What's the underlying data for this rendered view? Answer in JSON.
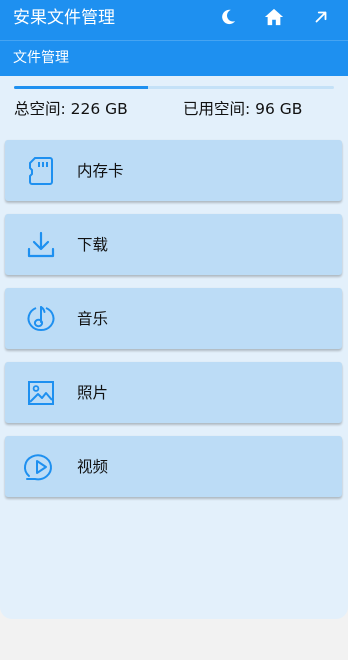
{
  "appbar": {
    "title": "安果文件管理",
    "actions": [
      {
        "icon": "moon-icon"
      },
      {
        "icon": "home-icon"
      },
      {
        "icon": "arrow-up-right-icon"
      }
    ]
  },
  "subbar": {
    "title": "文件管理"
  },
  "storage": {
    "total_label": "总空间: 226 GB",
    "used_label": "已用空间: 96 GB",
    "used_fraction": 0.42
  },
  "categories": [
    {
      "label": "内存卡",
      "icon": "sd-card-icon"
    },
    {
      "label": "下载",
      "icon": "download-icon"
    },
    {
      "label": "音乐",
      "icon": "music-icon"
    },
    {
      "label": "照片",
      "icon": "image-icon"
    },
    {
      "label": "视频",
      "icon": "video-icon"
    }
  ],
  "colors": {
    "primary": "#1e90f0",
    "panel": "#e3f0fb",
    "card": "#bcdcf6",
    "icon": "#1e90f0"
  }
}
